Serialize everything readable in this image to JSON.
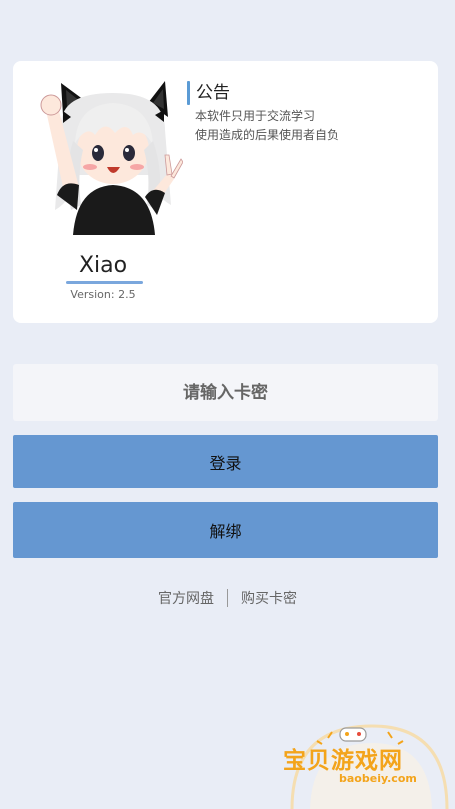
{
  "notice": {
    "title": "公告",
    "line1": "本软件只用于交流学习",
    "line2": "使用造成的后果使用者自负"
  },
  "app": {
    "name": "Xiao",
    "version": "Version: 2.5"
  },
  "form": {
    "card_placeholder": "请输入卡密",
    "login_label": "登录",
    "unbind_label": "解绑"
  },
  "links": {
    "cloud_disk": "官方网盘",
    "buy_card": "购买卡密"
  },
  "watermark": {
    "text": "宝贝游戏网",
    "url": "baobeiy.com"
  },
  "colors": {
    "background": "#e9edf6",
    "button": "#6597d1",
    "accent": "#5b9bd5",
    "watermark": "#f3a41b"
  }
}
